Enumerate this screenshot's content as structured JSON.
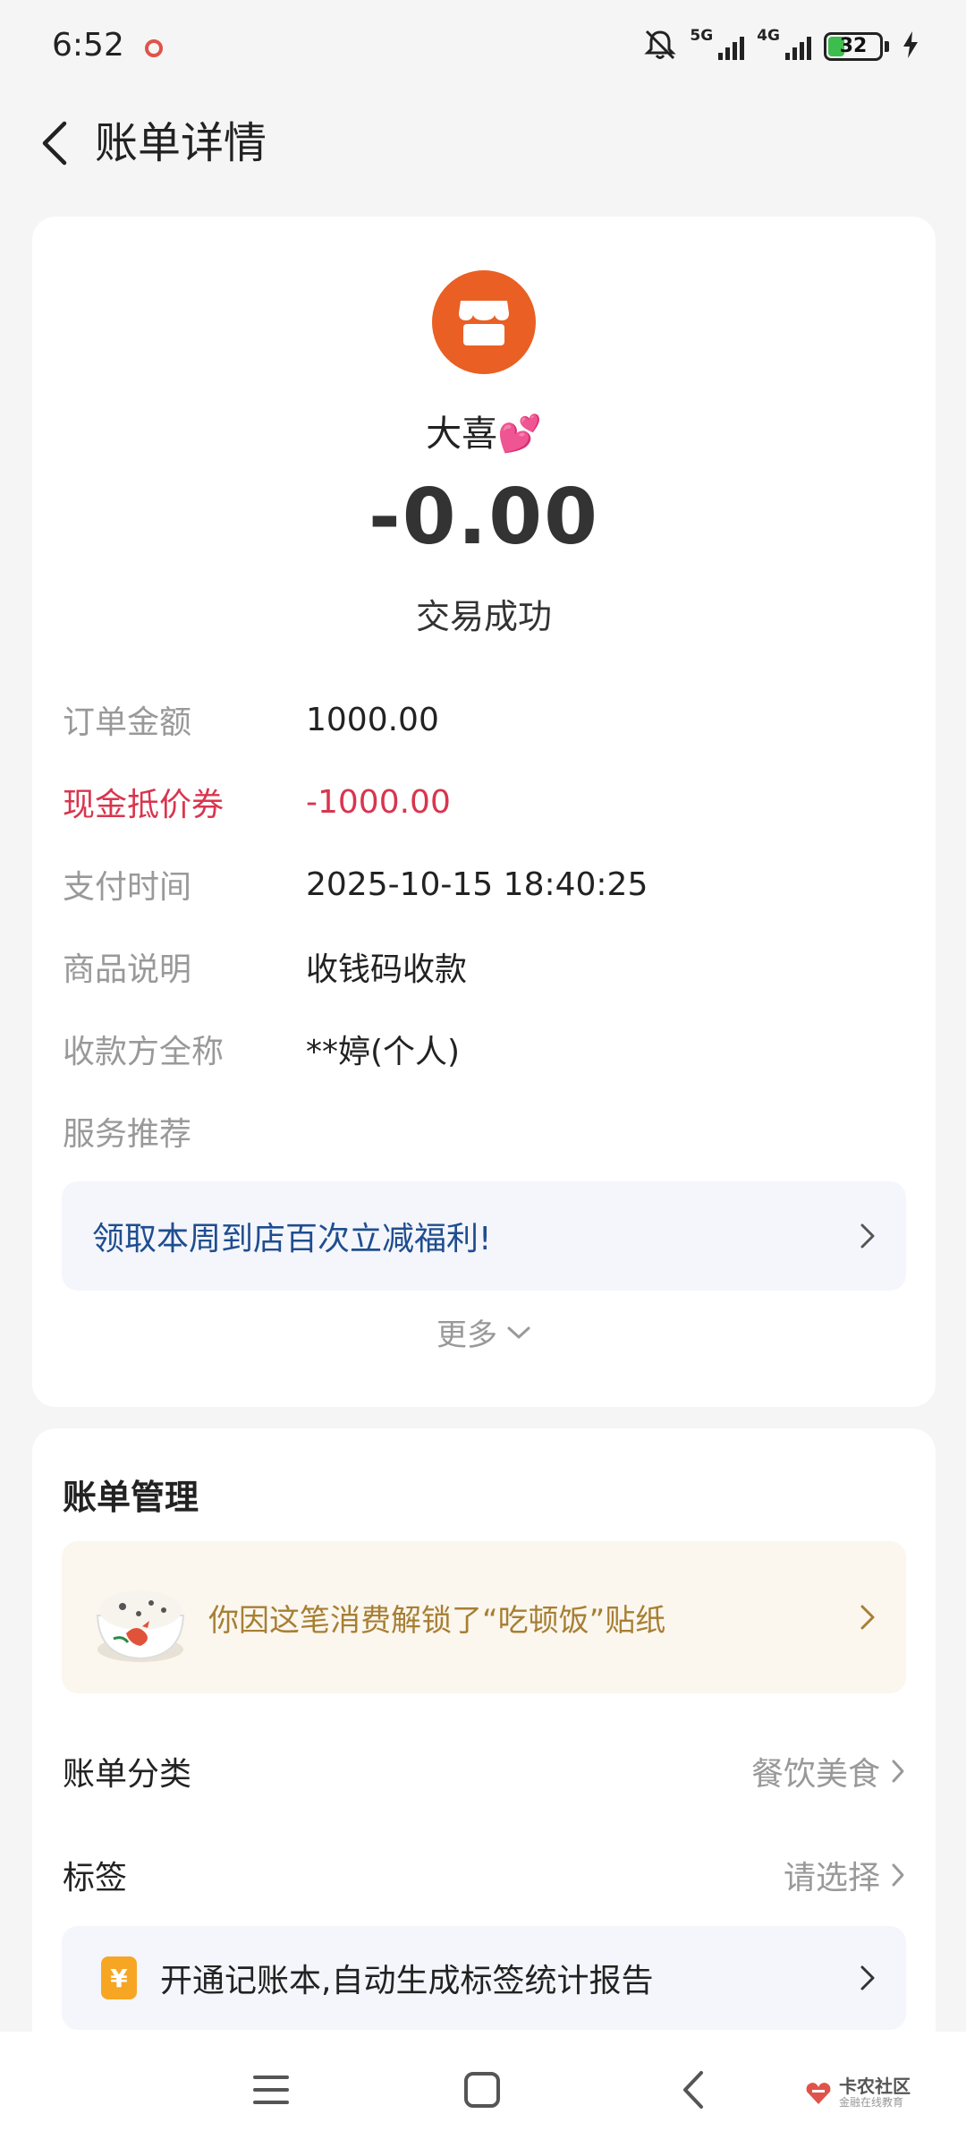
{
  "status_bar": {
    "time": "6:52",
    "net1": "5G",
    "net2": "4G",
    "battery": "32",
    "battery_level": 0.32
  },
  "header": {
    "title": "账单详情"
  },
  "bill": {
    "merchant_name": "大喜💕",
    "amount": "-0.00",
    "status": "交易成功",
    "details": [
      {
        "label": "订单金额",
        "value": "1000.00"
      },
      {
        "label": "现金抵价券",
        "value": "-1000.00"
      },
      {
        "label": "支付时间",
        "value": "2025-10-15 18:40:25"
      },
      {
        "label": "商品说明",
        "value": "收钱码收款"
      },
      {
        "label": "收款方全称",
        "value": "**婷(个人)"
      },
      {
        "label": "服务推荐",
        "value": ""
      }
    ],
    "promo": "领取本周到店百次立减福利!",
    "more": "更多"
  },
  "management": {
    "title": "账单管理",
    "sticker": "你因这笔消费解锁了“吃顿饭”贴纸",
    "category_label": "账单分类",
    "category_value": "餐饮美食",
    "tag_label": "标签",
    "tag_value": "请选择",
    "ledger_icon": "¥",
    "ledger_text": "开通记账本,自动生成标签统计报告"
  },
  "watermark": {
    "title": "卡农社区",
    "subtitle": "金融在线教育"
  },
  "colors": {
    "accent_orange": "#ea5f23",
    "danger": "#d9354e",
    "promo_blue": "#1f4d8f",
    "sticker_gold": "#a77f33"
  }
}
